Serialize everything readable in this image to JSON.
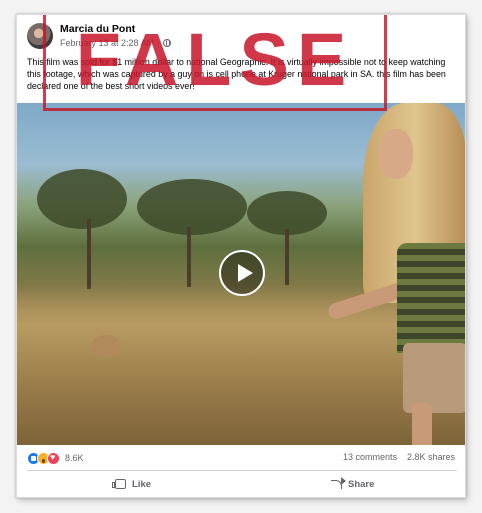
{
  "post": {
    "author": "Marcia du Pont",
    "timestamp": "February 13 at 2:28 AM",
    "separator": "·",
    "text": "This film was sold for $1 million dollar to national Geographic. It is virtually impossible not to keep watching this footage, which was captured by a guy on is cell phone at Kruger national park in SA. this film has been declared one of the best short videos ever!"
  },
  "overlay": {
    "stamp_text": "FALSE",
    "stamp_color": "#c81428"
  },
  "footer": {
    "reaction_count": "8.6K",
    "comments": "13 comments",
    "shares": "2.8K shares",
    "like_label": "Like",
    "share_label": "Share"
  },
  "icons": {
    "privacy": "globe-icon",
    "play": "play-icon",
    "reactions": [
      "like-reaction-icon",
      "wow-reaction-icon",
      "love-reaction-icon"
    ]
  }
}
